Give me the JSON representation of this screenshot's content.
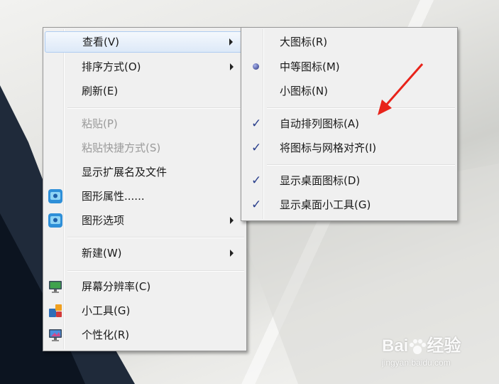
{
  "main_menu": {
    "items": [
      {
        "label": "查看(V)"
      },
      {
        "label": "排序方式(O)"
      },
      {
        "label": "刷新(E)"
      },
      {
        "label": "粘贴(P)"
      },
      {
        "label": "粘贴快捷方式(S)"
      },
      {
        "label": "显示扩展名及文件"
      },
      {
        "label": "图形属性......"
      },
      {
        "label": "图形选项"
      },
      {
        "label": "新建(W)"
      },
      {
        "label": "屏幕分辨率(C)"
      },
      {
        "label": "小工具(G)"
      },
      {
        "label": "个性化(R)"
      }
    ]
  },
  "sub_menu": {
    "items": [
      {
        "label": "大图标(R)"
      },
      {
        "label": "中等图标(M)"
      },
      {
        "label": "小图标(N)"
      },
      {
        "label": "自动排列图标(A)"
      },
      {
        "label": "将图标与网格对齐(I)"
      },
      {
        "label": "显示桌面图标(D)"
      },
      {
        "label": "显示桌面小工具(G)"
      }
    ],
    "check_glyph": "✓"
  },
  "watermark": {
    "brand": "Bai",
    "brand_tail": "经验",
    "url": "jingyan.baidu.com"
  },
  "colors": {
    "highlight_border": "#aeccf1",
    "check": "#2a3f8c",
    "arrow_annotation": "#e8231a"
  }
}
